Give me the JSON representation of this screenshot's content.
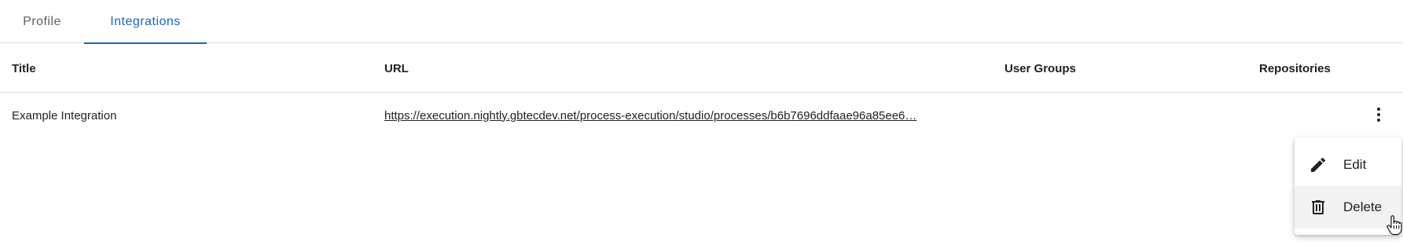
{
  "tabs": [
    {
      "label": "Profile",
      "active": false
    },
    {
      "label": "Integrations",
      "active": true
    }
  ],
  "table": {
    "columns": [
      "Title",
      "URL",
      "User Groups",
      "Repositories"
    ],
    "rows": [
      {
        "title": "Example Integration",
        "url": "https://execution.nightly.gbtecdev.net/process-execution/studio/processes/b6b7696ddfaae96a85ee6…",
        "user_groups": "",
        "repositories": ""
      }
    ]
  },
  "row_menu": {
    "items": [
      {
        "label": "Edit",
        "icon": "pencil-icon"
      },
      {
        "label": "Delete",
        "icon": "trash-icon",
        "hovered": true
      }
    ]
  },
  "colors": {
    "accent": "#1565c0",
    "divider": "#e0e0e0",
    "menu_hover": "#f2f2f2"
  }
}
